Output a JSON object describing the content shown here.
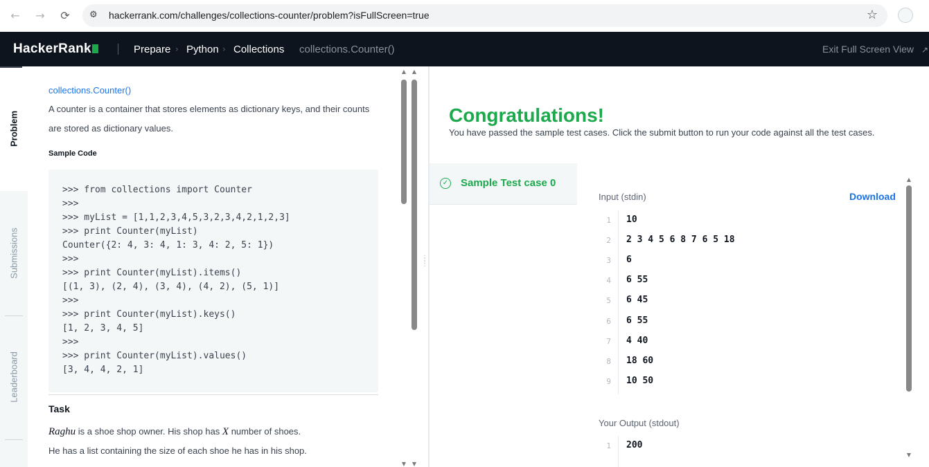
{
  "browser": {
    "url": "hackerrank.com/challenges/collections-counter/problem?isFullScreen=true"
  },
  "header": {
    "logo": "HackerRank",
    "breadcrumbs": [
      "Prepare",
      "Python",
      "Collections",
      "collections.Counter()"
    ],
    "exit_fullscreen": "Exit Full Screen View"
  },
  "tabs": [
    {
      "label": "Problem",
      "active": true
    },
    {
      "label": "Submissions",
      "active": false
    },
    {
      "label": "Leaderboard",
      "active": false
    }
  ],
  "problem": {
    "link": "collections.Counter()",
    "intro": "A counter is a container that stores elements as dictionary keys, and their counts are stored as dictionary values.",
    "sample_code_heading": "Sample Code",
    "code_lines": [
      ">>> from collections import Counter",
      ">>>",
      ">>> myList = [1,1,2,3,4,5,3,2,3,4,2,1,2,3]",
      ">>> print Counter(myList)",
      "Counter({2: 4, 3: 4, 1: 3, 4: 2, 5: 1})",
      ">>>",
      ">>> print Counter(myList).items()",
      "[(1, 3), (2, 4), (3, 4), (4, 2), (5, 1)]",
      ">>>",
      ">>> print Counter(myList).keys()",
      "[1, 2, 3, 4, 5]",
      ">>>",
      ">>> print Counter(myList).values()",
      "[3, 4, 4, 2, 1]"
    ],
    "task_heading": "Task",
    "task_line1_math1": "Raghu",
    "task_line1_mid": " is a shoe shop owner. His shop has ",
    "task_line1_math2": "X",
    "task_line1_end": " number of shoes.",
    "task_line2": "He has a list containing the size of each shoe he has in his shop."
  },
  "result": {
    "title": "Congratulations!",
    "message": "You have passed the sample test cases. Click the submit button to run your code against all the test cases.",
    "test_case_label": "Sample Test case 0",
    "input_label": "Input (stdin)",
    "download_label": "Download",
    "input_lines": [
      {
        "n": "1",
        "v": "10"
      },
      {
        "n": "2",
        "v": "2 3 4 5 6 8 7 6 5 18"
      },
      {
        "n": "3",
        "v": "6"
      },
      {
        "n": "4",
        "v": "6 55"
      },
      {
        "n": "5",
        "v": "6 45"
      },
      {
        "n": "6",
        "v": "6 55"
      },
      {
        "n": "7",
        "v": "4 40"
      },
      {
        "n": "8",
        "v": "18 60"
      },
      {
        "n": "9",
        "v": "10 50"
      }
    ],
    "output_label": "Your Output (stdout)",
    "output_lines": [
      {
        "n": "1",
        "v": "200"
      }
    ]
  },
  "colors": {
    "brand_green": "#1ba94c",
    "header_bg": "#0e141e",
    "link_blue": "#1a73e8"
  }
}
